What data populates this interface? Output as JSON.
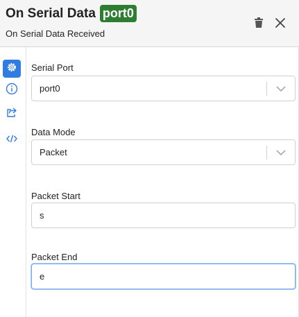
{
  "header": {
    "title": "On Serial Data",
    "tag": "port0",
    "subtitle": "On Serial Data Received"
  },
  "toolbar": {
    "trash_icon": "trash-icon",
    "close_icon": "close-icon"
  },
  "sidebar": {
    "items": [
      {
        "icon": "gear-icon",
        "active": true
      },
      {
        "icon": "info-icon",
        "active": false
      },
      {
        "icon": "share-icon",
        "active": false
      },
      {
        "icon": "code-icon",
        "active": false
      }
    ]
  },
  "form": {
    "serial_port": {
      "label": "Serial Port",
      "value": "port0"
    },
    "data_mode": {
      "label": "Data Mode",
      "value": "Packet"
    },
    "packet_start": {
      "label": "Packet Start",
      "value": "s"
    },
    "packet_end": {
      "label": "Packet End",
      "value": "e"
    }
  },
  "colors": {
    "tag_bg": "#2e7d32",
    "active_side": "#2f7de1",
    "icon_blue": "#2f7de1",
    "focus_border": "#7aaef0"
  }
}
